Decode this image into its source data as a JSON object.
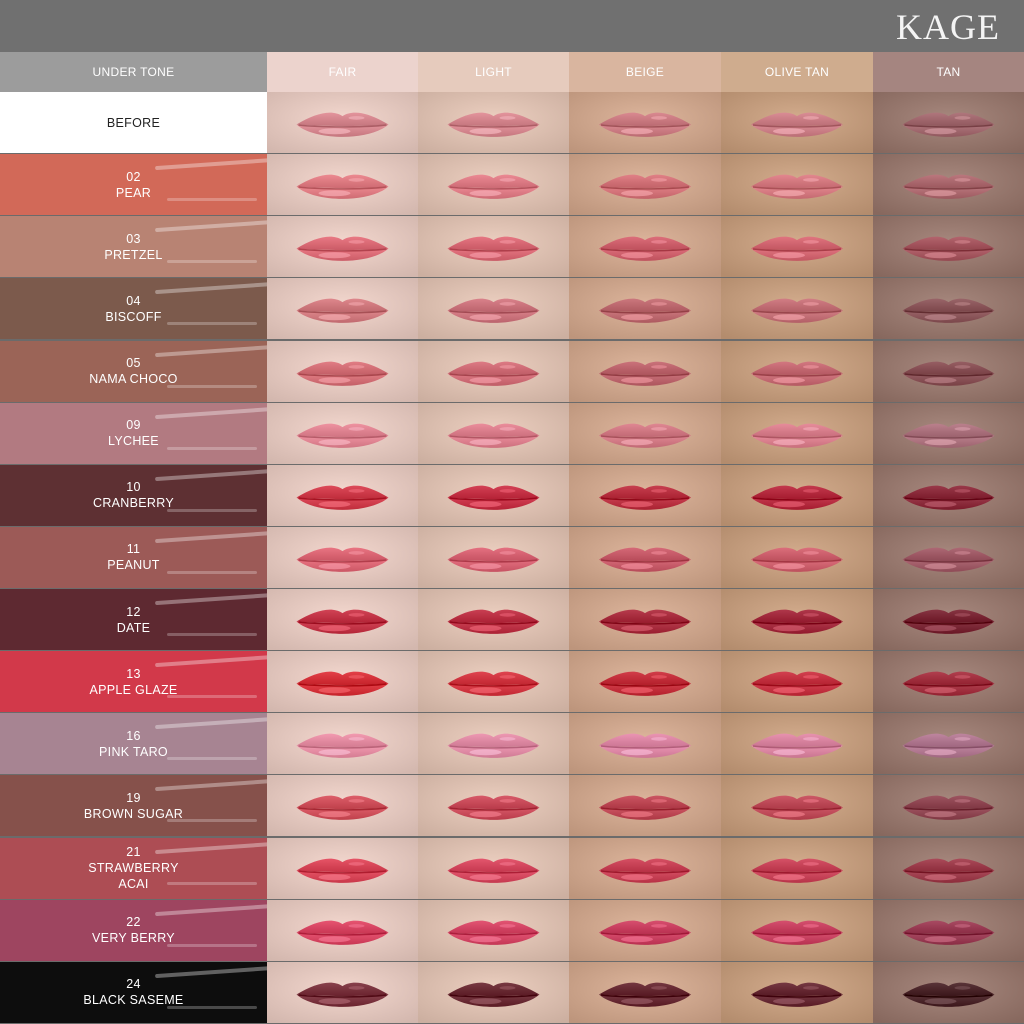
{
  "brand": "KAGE",
  "header": {
    "first": "UNDER TONE",
    "tones": [
      {
        "label": "FAIR",
        "bg": "#ecd3cd",
        "skin": "#e9cdc4"
      },
      {
        "label": "LIGHT",
        "bg": "#e6cbbd",
        "skin": "#e2c5b6"
      },
      {
        "label": "BEIGE",
        "bg": "#d9b59f",
        "skin": "#d3ab92"
      },
      {
        "label": "OLIVE TAN",
        "bg": "#cfac8e",
        "skin": "#c9a283"
      },
      {
        "label": "TAN",
        "bg": "#a58580",
        "skin": "#9d7e74"
      }
    ]
  },
  "rows": [
    {
      "num": "",
      "name": "BEFORE",
      "swatch": "#ffffff",
      "lip": [
        "#d98a92",
        "#d98a92",
        "#cf7f86",
        "#cf828a",
        "#a56c72"
      ]
    },
    {
      "num": "02",
      "name": "PEAR",
      "swatch": "#d26958",
      "lip": [
        "#e27f86",
        "#e17f89",
        "#d6767c",
        "#d87d84",
        "#b06d73"
      ]
    },
    {
      "num": "03",
      "name": "PRETZEL",
      "swatch": "#b88373",
      "lip": [
        "#df6f7a",
        "#dc6c78",
        "#d26470",
        "#d66a75",
        "#a95a63"
      ]
    },
    {
      "num": "04",
      "name": "BISCOFF",
      "swatch": "#7c5a4c",
      "lip": [
        "#d47d82",
        "#cf7780",
        "#c16d73",
        "#c7737a",
        "#8f5a5e"
      ]
    },
    {
      "num": "05",
      "name": "NAMA CHOCO",
      "swatch": "#9b6457",
      "lip": [
        "#d7737a",
        "#d3707a",
        "#c06870",
        "#c86d76",
        "#8c5459"
      ]
    },
    {
      "num": "09",
      "name": "LYCHEE",
      "swatch": "#b27a81",
      "lip": [
        "#e48896",
        "#e08391",
        "#d57d88",
        "#dc8290",
        "#b07682"
      ]
    },
    {
      "num": "10",
      "name": "CRANBERRY",
      "swatch": "#5e3033",
      "lip": [
        "#d3404f",
        "#c9364a",
        "#bd3545",
        "#b92f43",
        "#8f2f3f"
      ]
    },
    {
      "num": "11",
      "name": "PEANUT",
      "swatch": "#9c5a57",
      "lip": [
        "#df6a78",
        "#da6676",
        "#cb5f6d",
        "#d16471",
        "#a35e6a"
      ]
    },
    {
      "num": "12",
      "name": "DATE",
      "swatch": "#5e2931",
      "lip": [
        "#c7394b",
        "#bf3548",
        "#ac3142",
        "#a52d40",
        "#7d2a38"
      ]
    },
    {
      "num": "13",
      "name": "APPLE GLAZE",
      "swatch": "#d2394a",
      "lip": [
        "#d9363e",
        "#d53a45",
        "#c7333f",
        "#c83645",
        "#a63544"
      ]
    },
    {
      "num": "16",
      "name": "PINK TARO",
      "swatch": "#a78492",
      "lip": [
        "#e890a6",
        "#e38ea8",
        "#e08aa8",
        "#dd88a4",
        "#b47b94"
      ]
    },
    {
      "num": "19",
      "name": "BROWN SUGAR",
      "swatch": "#86514b",
      "lip": [
        "#d3545f",
        "#cd4f5e",
        "#c14b58",
        "#c24e5c",
        "#934a56"
      ]
    },
    {
      "num": "21",
      "name": "STRAWBERRY\nACAI",
      "swatch": "#ad4d54",
      "lip": [
        "#dc4a5c",
        "#d94c63",
        "#cb4559",
        "#cb475c",
        "#a0404f"
      ]
    },
    {
      "num": "22",
      "name": "VERY BERRY",
      "swatch": "#9e4560",
      "lip": [
        "#dc4a67",
        "#d84a69",
        "#cd4464",
        "#cb4564",
        "#9e4058"
      ]
    },
    {
      "num": "24",
      "name": "BLACK SASEME",
      "swatch": "#0d0d0d",
      "lip": [
        "#7e3742",
        "#6e2f38",
        "#6a2d36",
        "#6b2e38",
        "#4f2a2e"
      ]
    }
  ]
}
